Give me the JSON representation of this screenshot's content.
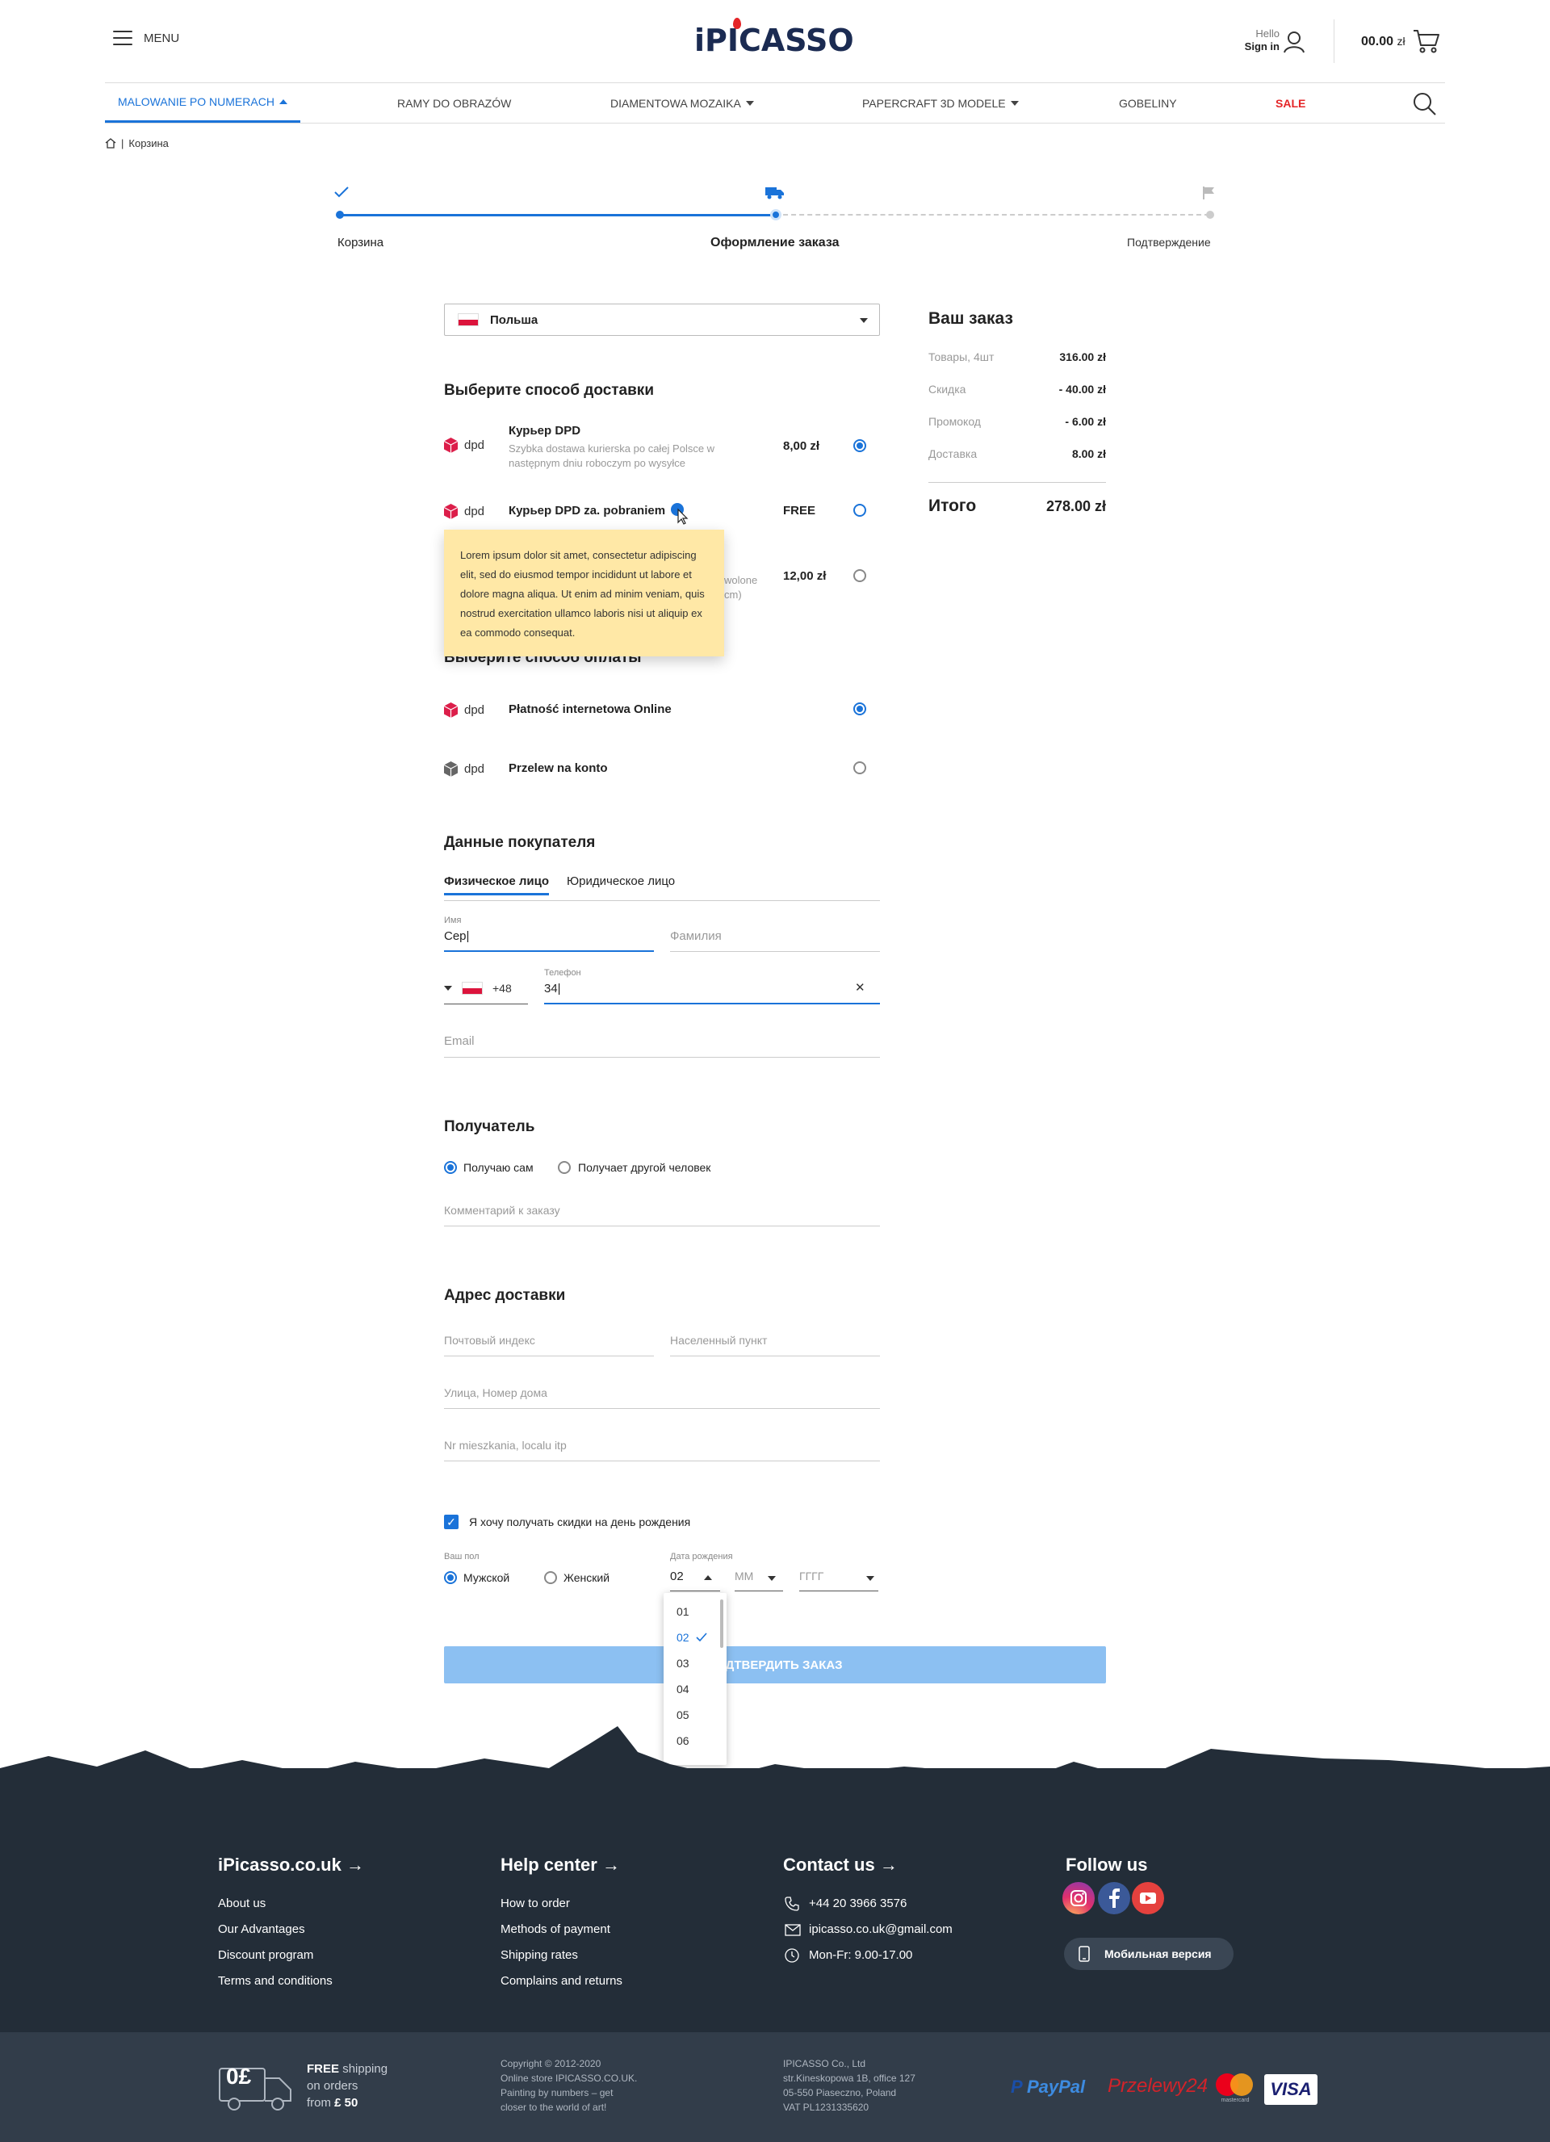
{
  "header": {
    "menu_label": "MENU",
    "logo": "iPICASSO",
    "hello": "Hello",
    "sign_in": "Sign in",
    "cart_amount": "00.00",
    "cart_currency": "zł"
  },
  "nav": {
    "items": [
      {
        "label": "MALOWANIE PO NUMERACH"
      },
      {
        "label": "RAMY DO OBRAZÓW"
      },
      {
        "label": "DIAMENTOWA MOZAIKA"
      },
      {
        "label": "PAPERCRAFT 3D MODELE"
      },
      {
        "label": "GOBELINY"
      },
      {
        "label": "SALE"
      }
    ]
  },
  "breadcrumb": {
    "sep": "|",
    "current": "Корзина"
  },
  "stepper": {
    "steps": [
      {
        "label": "Корзина"
      },
      {
        "label": "Оформление заказа"
      },
      {
        "label": "Подтверждение"
      }
    ]
  },
  "country": {
    "selected": "Польша"
  },
  "delivery": {
    "title": "Выберите способ доставки",
    "options": [
      {
        "brand": "dpd",
        "title": "Курьер DPD",
        "desc1": "Szybka dostawa kurierska po całej Polsce w",
        "desc2": "następnym dniu roboczym po wysyłce",
        "price": "8,00 zł",
        "selected": true
      },
      {
        "brand": "dpd",
        "title": "Курьер DPD za. pobraniem",
        "price": "FREE",
        "selected": false
      },
      {
        "brand": "dpd",
        "desc_frag1": "wolone",
        "desc_frag2": "cm)",
        "price": "12,00 zł",
        "selected": false
      }
    ],
    "tooltip": "Lorem ipsum dolor sit amet, consectetur adipiscing elit, sed do eiusmod tempor incididunt ut labore et dolore magna aliqua. Ut enim ad minim veniam, quis nostrud exercitation ullamco laboris nisi ut aliquip ex ea commodo consequat."
  },
  "payment": {
    "title": "Выберите способ оплаты",
    "options": [
      {
        "brand": "dpd",
        "title": "Płatność internetowa Online",
        "selected": true
      },
      {
        "brand": "dpd",
        "title": "Przelew na konto",
        "selected": false
      }
    ]
  },
  "buyer": {
    "title": "Данные покупателя",
    "tabs": [
      "Физическое лицо",
      "Юридическое лицо"
    ],
    "name_label": "Имя",
    "name_value": "Сер|",
    "surname_ph": "Фамилия",
    "phone_code": "+48",
    "phone_label": "Телефон",
    "phone_value": "34|",
    "clear_icon": "✕",
    "email_ph": "Email"
  },
  "recipient": {
    "title": "Получатель",
    "opt_self": "Получаю сам",
    "opt_other": "Получает другой человек",
    "comment_ph": "Комментарий к заказу"
  },
  "address": {
    "title": "Адрес доставки",
    "postal_ph": "Почтовый индекс",
    "city_ph": "Населенный пункт",
    "street_ph": "Улица, Номер дома",
    "apartment_ph": "Nr mieszkania, localu itp"
  },
  "birthday": {
    "checkbox_label": "Я хочу получать скидки на день рождения",
    "gender_label": "Ваш пол",
    "male": "Мужской",
    "female": "Женский",
    "date_label": "Дата рождения",
    "day_value": "02",
    "month_ph": "ММ",
    "year_ph": "ГГГГ",
    "day_options": [
      "01",
      "02",
      "03",
      "04",
      "05",
      "06"
    ]
  },
  "confirm_label": "ПОДТВЕРДИТЬ ЗАКАЗ",
  "summary": {
    "title": "Ваш заказ",
    "rows": [
      {
        "label": "Товары, 4шт",
        "value": "316.00 zł"
      },
      {
        "label": "Скидка",
        "value": "- 40.00 zł"
      },
      {
        "label": "Промокод",
        "value": "- 6.00 zł"
      },
      {
        "label": "Доставка",
        "value": "8.00 zł"
      }
    ],
    "total_label": "Итого",
    "total_value": "278.00 zł"
  },
  "footer": {
    "col1": {
      "title": "iPicasso.co.uk",
      "links": [
        "About us",
        "Our Advantages",
        "Discount program",
        "Terms and conditions"
      ]
    },
    "col2": {
      "title": "Help center",
      "links": [
        "How to order",
        "Methods of payment",
        "Shipping rates",
        "Complains and returns"
      ]
    },
    "col3": {
      "title": "Contact us",
      "phone": "+44 20 3966 3576",
      "email": "ipicasso.co.uk@gmail.com",
      "hours": "Mon-Fr: 9.00-17.00"
    },
    "col4": {
      "title": "Follow us",
      "mobile": "Мобильная версия"
    },
    "shipping": {
      "zero": "0£",
      "line1": "FREE",
      "line1b": "shipping",
      "line2": "on orders",
      "line3": "from",
      "line3b": "£ 50"
    },
    "copyright": [
      "Copyright © 2012-2020",
      "Online store IPICASSO.CO.UK.",
      "Painting by numbers – get",
      "closer to the world of art!"
    ],
    "company": [
      "IPICASSO Co., Ltd",
      "str.Kineskopowa 1B, office 127",
      "05-550 Piaseczno, Poland",
      "VAT PL1231335620"
    ],
    "payments": {
      "paypal": "PayPal",
      "p24": "Przelewy24",
      "mc": "mastercard",
      "visa": "VISA"
    }
  },
  "colors": {
    "accent": "#1a73d9",
    "sale": "#e42528",
    "footer": "#232d38",
    "tooltip": "#ffe8a6"
  }
}
